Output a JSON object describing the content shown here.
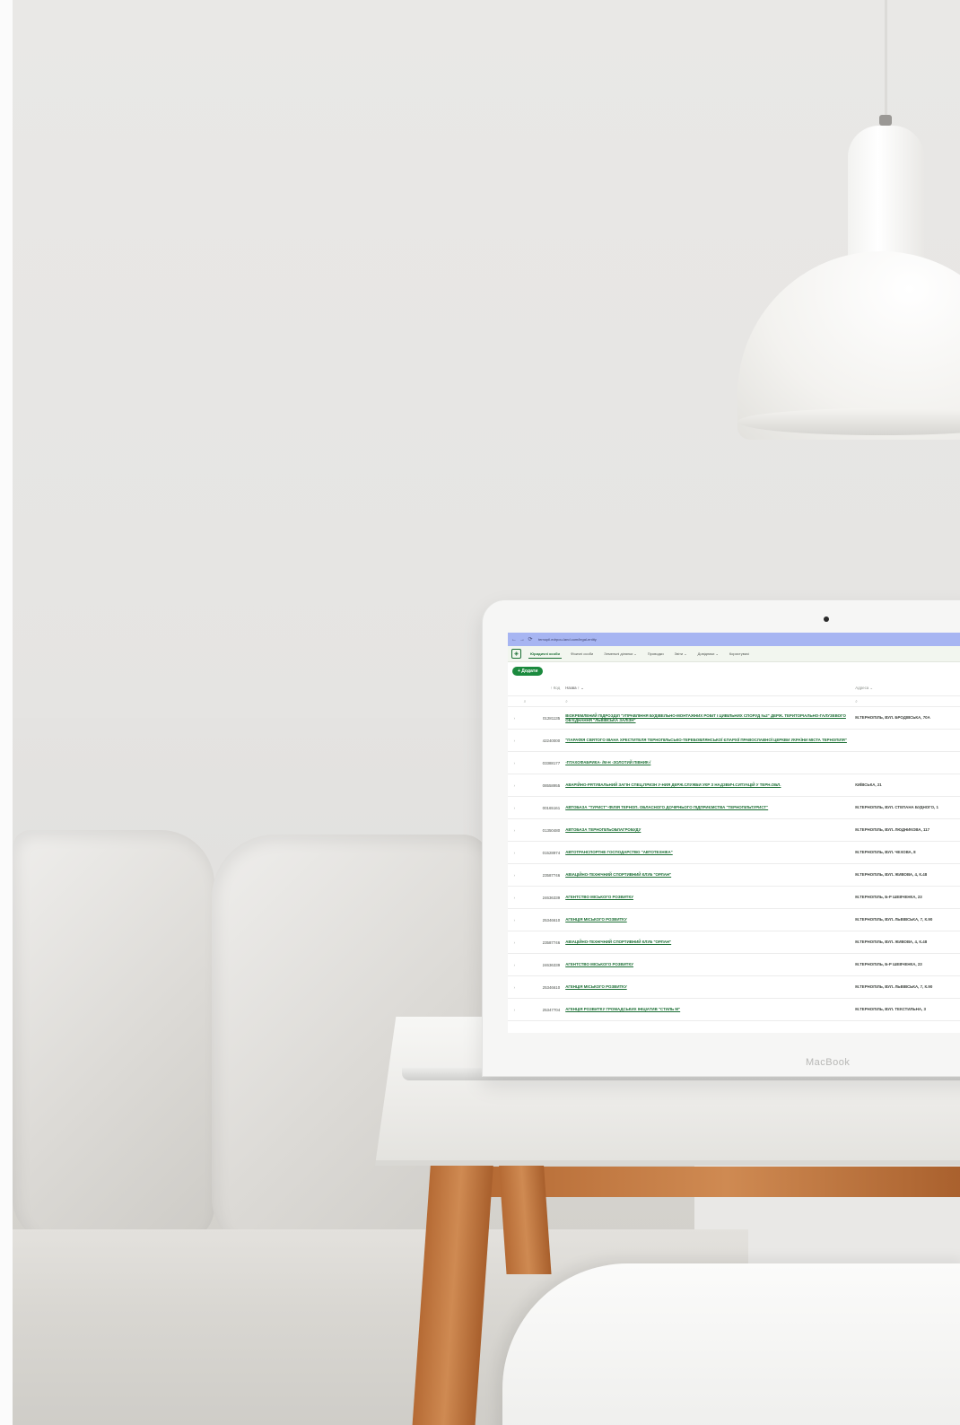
{
  "brand": "MacBook",
  "browser": {
    "back": "←",
    "forward": "→",
    "reload": "⟳",
    "url": "ternopil.edrpou-land.com/legal-entity"
  },
  "nav": {
    "items": [
      {
        "label": "Юридичні особи",
        "active": true
      },
      {
        "label": "Фізичні особи",
        "active": false
      },
      {
        "label": "Земельні ділянки ⌄",
        "active": false
      },
      {
        "label": "Проводки",
        "active": false
      },
      {
        "label": "Звіти ⌄",
        "active": false
      },
      {
        "label": "Довідники ⌄",
        "active": false
      },
      {
        "label": "Користувачі",
        "active": false
      }
    ]
  },
  "toolbar": {
    "add_label": "+ Додати"
  },
  "table": {
    "columns": {
      "code": "↑ Код",
      "name": "Назва ↑ ⌄",
      "address": "Адреса ⌄"
    },
    "filter_icon": "⌕",
    "rows": [
      {
        "code": "01281135",
        "name": "ВІОКРЕМЛЕНИЙ ПІДРОЗДІЛ \"УПРАВЛІННЯ БУДІВЕЛЬНО-МОНТАЖНИХ РОБІТ І ЦИВІЛЬНИХ СПОРУД №2\" ДЕРЖ. ТЕРИТОРІАЛЬНО-ГАЛУЗЕВОГО ОБ'ЄДНАННЯ \"ЛЬВІВСЬКА ЗАЛІЗН\"",
        "address": "М.ТЕРНОПІЛЬ, ВУЛ. БРОДІВСЬКА, 70А"
      },
      {
        "code": "42240000",
        "name": "\"ПАРАФІЯ СВЯТОГО ІВАНА ХРЕСТИТЕЛЯ ТЕРНОПІЛЬСЬКО-ТЕРЕБОВЛЯНСЬКОЇ ЄПАРХІЇ ПРАВОСЛАВНОЇ ЦЕРКВИ УКРАЇНИ МІСТА ТЕРНОПІЛЯ\"",
        "address": ""
      },
      {
        "code": "03388177",
        "name": "-ПТАХОФАБРИКА- /М-Н -ЗОЛОТИЙ ПІВНИК-/",
        "address": ""
      },
      {
        "code": "08558955",
        "name": "АВАРІЙНО-РЯТУВАЛЬНИЙ ЗАГІН СПЕЦ.ПРИЗН У-НИЯ ДЕРЖ.СЛУЖБИ УКР З НАДЗВИЧ.СИТУАЦІЙ У ТЕРН.ОБЛ.",
        "address": "КИЇВСЬКА, 21"
      },
      {
        "code": "00165161",
        "name": "АВТОБАЗА \"ТУРИСТ\"-ФІЛІЯ ТЕРНОП. ОБЛАСНОГО ДОЧІРНЬОГО ПІДПРИЄМСТВА \"ТЕРНОПІЛЬТУРИСТ\"",
        "address": "М.ТЕРНОПІЛЬ, ВУЛ. СТЕПАНА БУДНОГО, 1"
      },
      {
        "code": "01350480",
        "name": "АВТОБАЗА ТЕРНОПІЛЬОБЛАГРОБУДУ",
        "address": "М.ТЕРНОПІЛЬ, ВУЛ. ЛЮДНИКОВА, 117"
      },
      {
        "code": "01528974",
        "name": "АВТОТРАНСПОРТНЕ ГОСПОДАРСТВО \"АВТОТЕХНІКА\"",
        "address": "М.ТЕРНОПІЛЬ, ВУЛ. ЧЕХОВА, 8"
      },
      {
        "code": "23587746",
        "name": "АВІАЦІЙНО-ТЕХНІЧНИЙ СПОРТИВНИЙ КЛУБ \"ОРЛАН\"",
        "address": "М.ТЕРНОПІЛЬ, ВУЛ. ЖИВОВА, 4, К.48"
      },
      {
        "code": "24636339",
        "name": "АГЕНТСТВО МІСЬКОГО РОЗВИТКУ",
        "address": "М.ТЕРНОПІЛЬ, Б-Р ШЕВЧЕНКА, 23"
      },
      {
        "code": "25346610",
        "name": "АГЕНЦІЯ МІСЬКОГО РОЗВИТКУ",
        "address": "М.ТЕРНОПІЛЬ, ВУЛ. ЛЬВІВСЬКА, 7, К.90"
      },
      {
        "code": "23587746",
        "name": "АВІАЦІЙНО-ТЕХНІЧНИЙ СПОРТИВНИЙ КЛУБ \"ОРЛАН\"",
        "address": "М.ТЕРНОПІЛЬ, ВУЛ. ЖИВОВА, 4, К.48"
      },
      {
        "code": "24636339",
        "name": "АГЕНТСТВО МІСЬКОГО РОЗВИТКУ",
        "address": "М.ТЕРНОПІЛЬ, Б-Р ШЕВЧЕНКА, 23"
      },
      {
        "code": "25346610",
        "name": "АГЕНЦІЯ МІСЬКОГО РОЗВИТКУ",
        "address": "М.ТЕРНОПІЛЬ, ВУЛ. ЛЬВІВСЬКА, 7, К.90"
      },
      {
        "code": "25347704",
        "name": "АГЕНЦІЯ РОЗВИТКУ ГРОМАДСЬКИХ ІНІЦІАТИВ \"СТИЛЬ М\"",
        "address": "М.ТЕРНОПІЛЬ, ВУЛ. ТЕКСТИЛЬНА, 3"
      }
    ]
  }
}
